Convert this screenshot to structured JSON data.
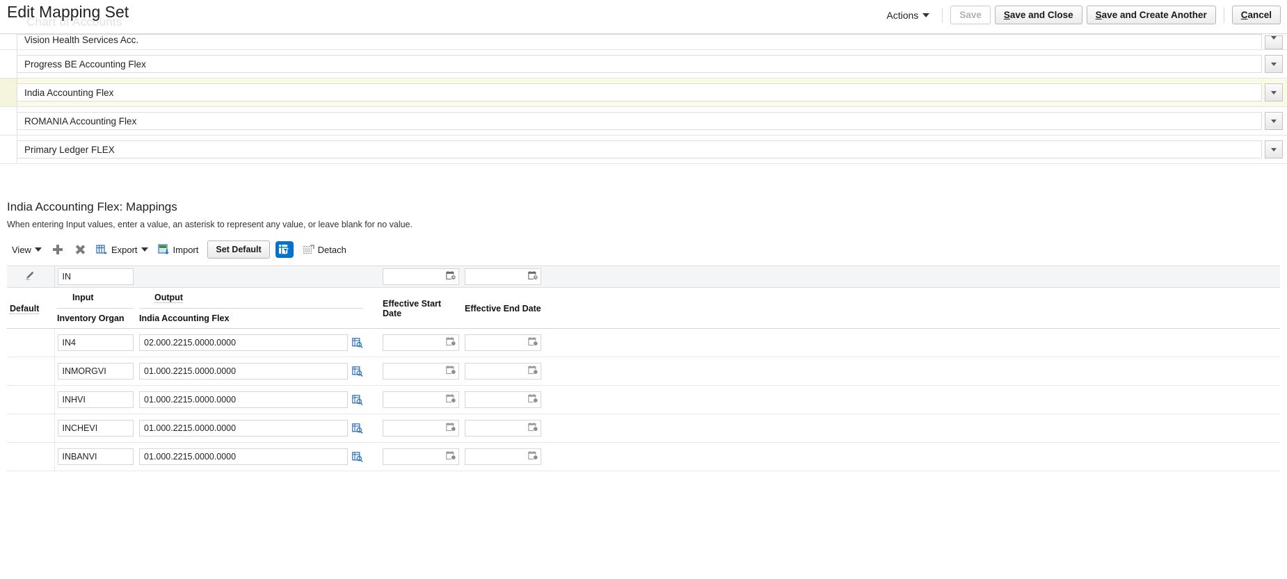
{
  "header": {
    "title": "Edit Mapping Set",
    "ghost_title": "Chart of Accounts",
    "actions_label": "Actions",
    "buttons": {
      "save": "Save",
      "save_and_close": "Save and Close",
      "save_and_create_another": "Save and Create Another",
      "cancel": "Cancel"
    }
  },
  "chart_of_accounts": {
    "rows": [
      {
        "label": "Vision Health Services Acc.",
        "selected": false,
        "clipped": true
      },
      {
        "label": "Progress BE Accounting Flex",
        "selected": false,
        "clipped": false
      },
      {
        "label": "India Accounting Flex",
        "selected": true,
        "clipped": false
      },
      {
        "label": "ROMANIA Accounting Flex",
        "selected": false,
        "clipped": false
      },
      {
        "label": "Primary Ledger FLEX",
        "selected": false,
        "clipped": false
      }
    ]
  },
  "mappings": {
    "title": "India Accounting Flex: Mappings",
    "description": "When entering Input values, enter a value, an asterisk to represent any value, or leave blank for no value.",
    "toolbar": {
      "view": "View",
      "add": "",
      "delete": "",
      "export": "Export",
      "import": "Import",
      "set_default": "Set Default",
      "query_by_example": "",
      "detach": "Detach"
    },
    "filter": {
      "input_value": "IN",
      "output_value": "",
      "effective_start_value": "",
      "effective_end_value": ""
    },
    "columns": {
      "default": "Default",
      "input_group": "Input",
      "output_group": "Output",
      "input_sub": "Inventory Organ",
      "output_sub": "India Accounting Flex",
      "effective_start": "Effective Start Date",
      "effective_end": "Effective End Date"
    },
    "rows": [
      {
        "default": "",
        "input": "IN4",
        "output": "02.000.2215.0000.0000",
        "effective_start": "",
        "effective_end": ""
      },
      {
        "default": "",
        "input": "INMORGVI",
        "output": "01.000.2215.0000.0000",
        "effective_start": "",
        "effective_end": ""
      },
      {
        "default": "",
        "input": "INHVI",
        "output": "01.000.2215.0000.0000",
        "effective_start": "",
        "effective_end": ""
      },
      {
        "default": "",
        "input": "INCHEVI",
        "output": "01.000.2215.0000.0000",
        "effective_start": "",
        "effective_end": ""
      },
      {
        "default": "",
        "input": "INBANVI",
        "output": "01.000.2215.0000.0000",
        "effective_start": "",
        "effective_end": ""
      }
    ]
  },
  "colors": {
    "accent_blue": "#0572ce",
    "selected_row": "#fafae6",
    "filter_row": "#f4f5f6"
  }
}
